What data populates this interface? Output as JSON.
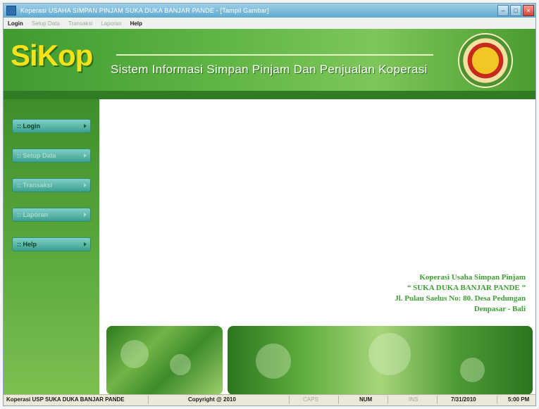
{
  "window": {
    "title": "Koperasi USAHA SIMPAN PINJAM SUKA DUKA BANJAR PANDE - [Tampil Gambar]",
    "controls": [
      "minimize",
      "maximize",
      "close"
    ]
  },
  "menu": [
    "Login",
    "Setup Data",
    "Transaksi",
    "Laporan",
    "Help"
  ],
  "banner": {
    "logo": "SiKop",
    "subtitle": "Sistem Informasi Simpan Pinjam Dan Penjualan Koperasi"
  },
  "sidebar": [
    {
      "label": ":: Login",
      "enabled": true
    },
    {
      "label": ":: Setup Data",
      "enabled": false
    },
    {
      "label": ":: Transaksi",
      "enabled": false
    },
    {
      "label": ":: Laporan",
      "enabled": false
    },
    {
      "label": ":: Help",
      "enabled": true
    }
  ],
  "address": {
    "line1": "Koperasi Usaha Simpan Pinjam",
    "line2": "“ SUKA DUKA BANJAR PANDE ”",
    "line3": "Jl. Pulau Saelus No: 80. Desa Pedungan",
    "line4": "Denpasar - Bali"
  },
  "status": {
    "org": "Koperasi USP SUKA DUKA BANJAR PANDE",
    "copyright": "Copyright @ 2010",
    "caps": "CAPS",
    "num": "NUM",
    "ins": "INS",
    "date": "7/31/2010",
    "time": "5:00 PM"
  },
  "colors": {
    "logo": "#f7e21a",
    "banner_green": "#5fb544",
    "sidebar_button": "#7fd0c5",
    "address_text": "#3e9e33"
  }
}
